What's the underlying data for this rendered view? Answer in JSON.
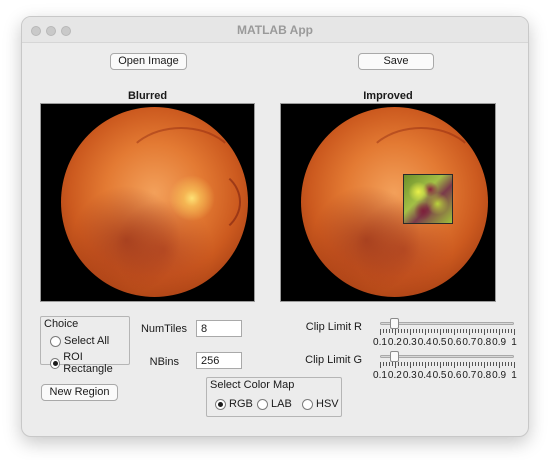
{
  "window": {
    "title": "MATLAB App"
  },
  "toolbar": {
    "open_label": "Open Image",
    "save_label": "Save"
  },
  "axes": {
    "left_title": "Blurred",
    "right_title": "Improved"
  },
  "choice": {
    "title": "Choice",
    "options": [
      {
        "label": "Select All",
        "selected": false
      },
      {
        "label": "ROI Rectangle",
        "selected": true
      }
    ],
    "new_region_label": "New Region"
  },
  "params": {
    "numtiles_label": "NumTiles",
    "numtiles_value": "8",
    "nbins_label": "NBins",
    "nbins_value": "256"
  },
  "colormap": {
    "title": "Select Color Map",
    "options": [
      {
        "label": "RGB",
        "selected": true
      },
      {
        "label": "LAB",
        "selected": false
      },
      {
        "label": "HSV",
        "selected": false
      }
    ]
  },
  "sliders": [
    {
      "label": "Clip Limit R",
      "value": 0.2
    },
    {
      "label": "Clip Limit G",
      "value": 0.2
    }
  ],
  "slider_ticks": [
    "0.1",
    "0.2",
    "0.3",
    "0.4",
    "0.5",
    "0.6",
    "0.7",
    "0.8",
    "0.9",
    "1"
  ]
}
